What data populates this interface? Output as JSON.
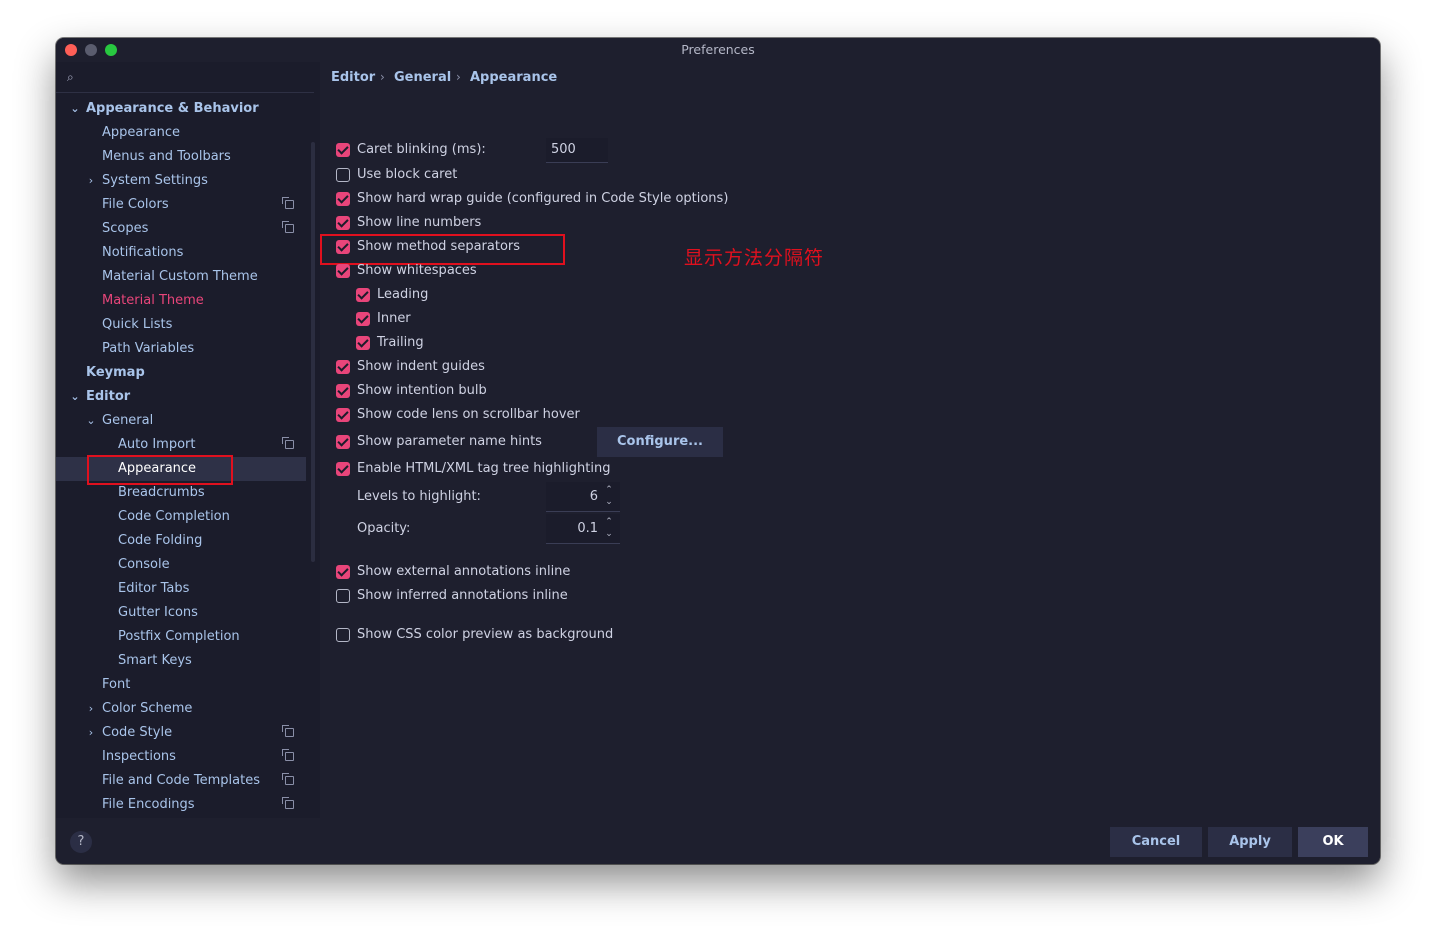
{
  "window": {
    "title": "Preferences",
    "traffic_lights": [
      "#ff5f57",
      "#5a5c6e",
      "#28c840"
    ]
  },
  "search": {
    "icon": "search-icon"
  },
  "sidebar": {
    "items": [
      {
        "label": "Appearance & Behavior",
        "chevron": "⌄"
      },
      {
        "label": "Appearance"
      },
      {
        "label": "Menus and Toolbars"
      },
      {
        "label": "System Settings",
        "chevron": "›"
      },
      {
        "label": "File Colors",
        "copy": true
      },
      {
        "label": "Scopes",
        "copy": true
      },
      {
        "label": "Notifications"
      },
      {
        "label": "Material Custom Theme"
      },
      {
        "label": "Material Theme",
        "accent": "#e8457a"
      },
      {
        "label": "Quick Lists"
      },
      {
        "label": "Path Variables"
      },
      {
        "label": "Keymap"
      },
      {
        "label": "Editor",
        "chevron": "⌄"
      },
      {
        "label": "General",
        "chevron": "⌄"
      },
      {
        "label": "Auto Import",
        "copy": true
      },
      {
        "label": "Appearance",
        "selected": true
      },
      {
        "label": "Breadcrumbs"
      },
      {
        "label": "Code Completion"
      },
      {
        "label": "Code Folding"
      },
      {
        "label": "Console"
      },
      {
        "label": "Editor Tabs"
      },
      {
        "label": "Gutter Icons"
      },
      {
        "label": "Postfix Completion"
      },
      {
        "label": "Smart Keys"
      },
      {
        "label": "Font"
      },
      {
        "label": "Color Scheme",
        "chevron": "›"
      },
      {
        "label": "Code Style",
        "chevron": "›",
        "copy": true
      },
      {
        "label": "Inspections",
        "copy": true
      },
      {
        "label": "File and Code Templates",
        "copy": true
      },
      {
        "label": "File Encodings",
        "copy": true
      }
    ]
  },
  "breadcrumb": {
    "items": [
      "Editor",
      "General",
      "Appearance"
    ],
    "separator": "›"
  },
  "options": [
    {
      "label": "Caret blinking (ms):",
      "checked": true
    },
    {
      "label": "Use block caret",
      "checked": false
    },
    {
      "label": "Show hard wrap guide (configured in Code Style options)",
      "checked": true
    },
    {
      "label": "Show line numbers",
      "checked": true
    },
    {
      "label": "Show method separators",
      "checked": true
    },
    {
      "label": "Show whitespaces",
      "checked": true
    },
    {
      "label": "Leading",
      "checked": true
    },
    {
      "label": "Inner",
      "checked": true
    },
    {
      "label": "Trailing",
      "checked": true
    },
    {
      "label": "Show indent guides",
      "checked": true
    },
    {
      "label": "Show intention bulb",
      "checked": true
    },
    {
      "label": "Show code lens on scrollbar hover",
      "checked": true
    },
    {
      "label": "Show parameter name hints",
      "checked": true
    },
    {
      "label": "Enable HTML/XML tag tree highlighting",
      "checked": true
    },
    {
      "label": "Show external annotations inline",
      "checked": true
    },
    {
      "label": "Show inferred annotations inline",
      "checked": false
    },
    {
      "label": "Show CSS color preview as background",
      "checked": false
    }
  ],
  "caret_blinking_value": "500",
  "configure_button": "Configure...",
  "levels": {
    "label": "Levels to highlight:",
    "value": "6"
  },
  "opacity": {
    "label": "Opacity:",
    "value": "0.1"
  },
  "spinner_arrows": {
    "up": "⌃",
    "down": "⌄"
  },
  "annotation": {
    "text": "显示方法分隔符",
    "color": "#e0101e"
  },
  "buttons": {
    "help": "?",
    "cancel": "Cancel",
    "apply": "Apply",
    "ok": "OK"
  },
  "colors": {
    "accent": "#e8457a",
    "link_blue": "#a9c4ea",
    "background": "#1e1f2e",
    "highlight_box": "#e0101e"
  }
}
